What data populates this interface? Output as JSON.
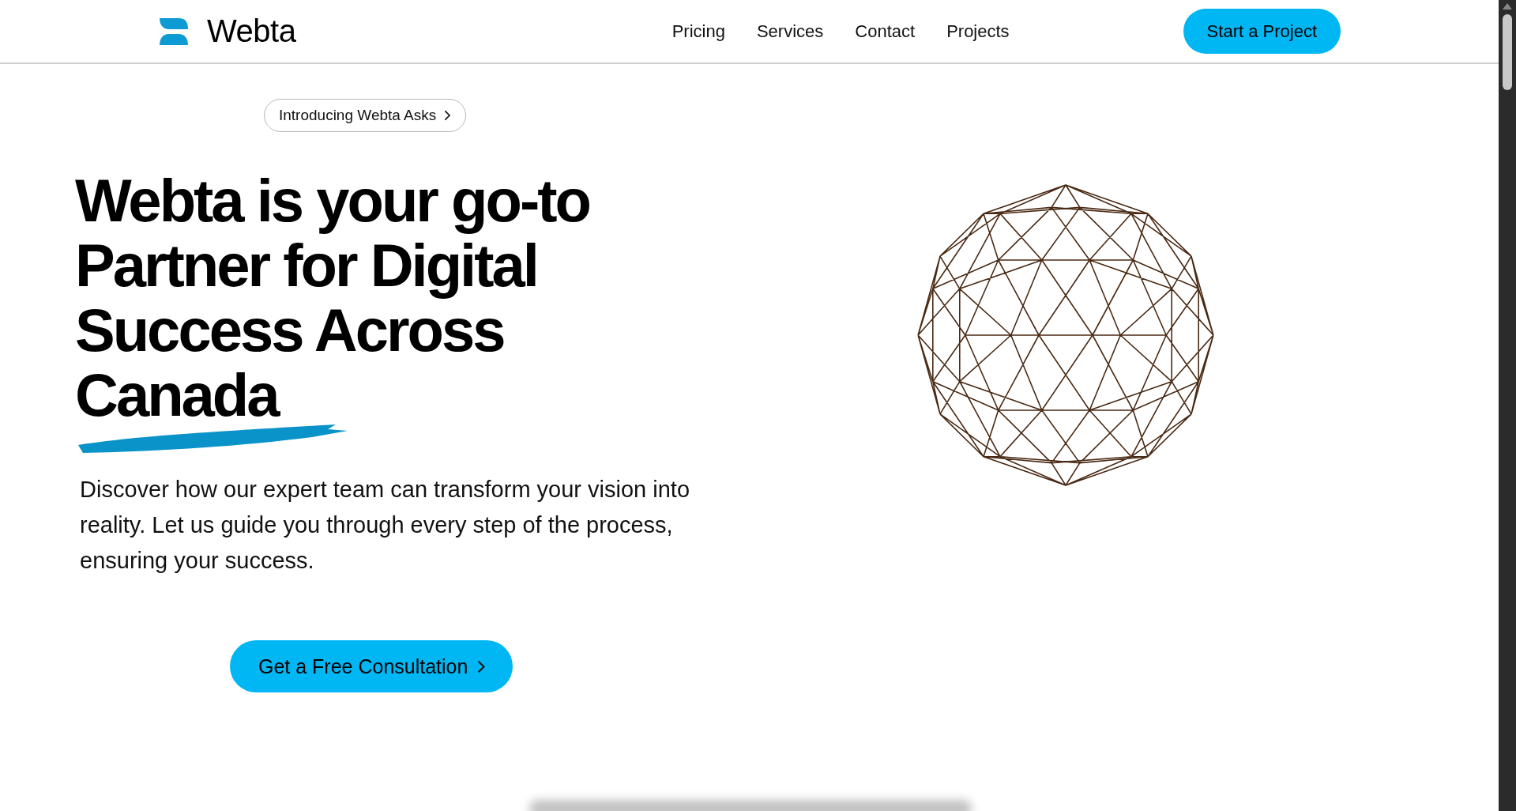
{
  "header": {
    "logo_text": "Webta",
    "nav": [
      {
        "label": "Pricing"
      },
      {
        "label": "Services"
      },
      {
        "label": "Contact"
      },
      {
        "label": "Projects"
      }
    ],
    "cta": "Start a Project"
  },
  "hero": {
    "badge": "Introducing Webta Asks",
    "heading_lines": [
      "Webta is your go-to",
      "Partner for Digital",
      "Success Across"
    ],
    "heading_highlight": "Canada",
    "description": "Discover how our expert team can transform your vision into reality. Let us guide you through every step of the process, ensuring your success.",
    "button": "Get a Free Consultation"
  }
}
